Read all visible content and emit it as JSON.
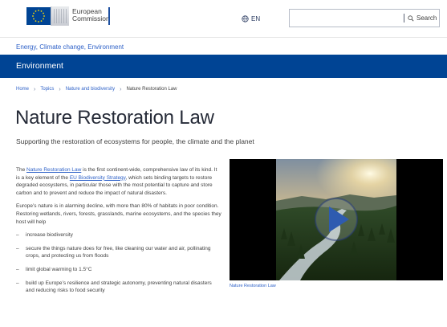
{
  "header": {
    "logo_line1": "European",
    "logo_line2": "Commission",
    "language_label": "EN",
    "language_icon": "globe-icon",
    "search_placeholder": "",
    "search_button_label": "Search",
    "search_icon": "magnifier-icon"
  },
  "site": {
    "name": "Energy, Climate change, Environment",
    "section_title": "Environment"
  },
  "breadcrumb": [
    "Home",
    "Topics",
    "Nature and biodiversity",
    "Nature Restoration Law"
  ],
  "page": {
    "title": "Nature Restoration Law",
    "subtitle": "Supporting the restoration of ecosystems for people, the climate and the planet"
  },
  "intro": {
    "prefix": "The ",
    "link1": "Nature Restoration Law",
    "middle": " is the first continent-wide, comprehensive law of its kind. It is a key element of the ",
    "link2": "EU Biodiversity Strategy",
    "suffix": ", which sets binding targets to restore degraded ecosystems, in particular those with the most potential to capture and store carbon and to prevent and reduce the impact of natural disasters."
  },
  "paragraph2": "Europe’s nature is in alarming decline, with more than 80% of habitats in poor condition. Restoring wetlands, rivers, forests, grasslands, marine ecosystems, and the species they host will help",
  "bullets": [
    "increase biodiversity",
    "secure the things nature does for free, like cleaning our water and air, pollinating crops, and protecting us from floods",
    "limit global warming to 1.5°C",
    "build up Europe’s resilience and strategic autonomy, preventing natural disasters and reducing risks to food security"
  ],
  "video": {
    "caption": "Nature Restoration Law",
    "play_icon": "play-icon"
  },
  "colors": {
    "brand_blue": "#004494",
    "link_blue": "#2f62c8",
    "text": "#404040",
    "title": "#262b38"
  }
}
